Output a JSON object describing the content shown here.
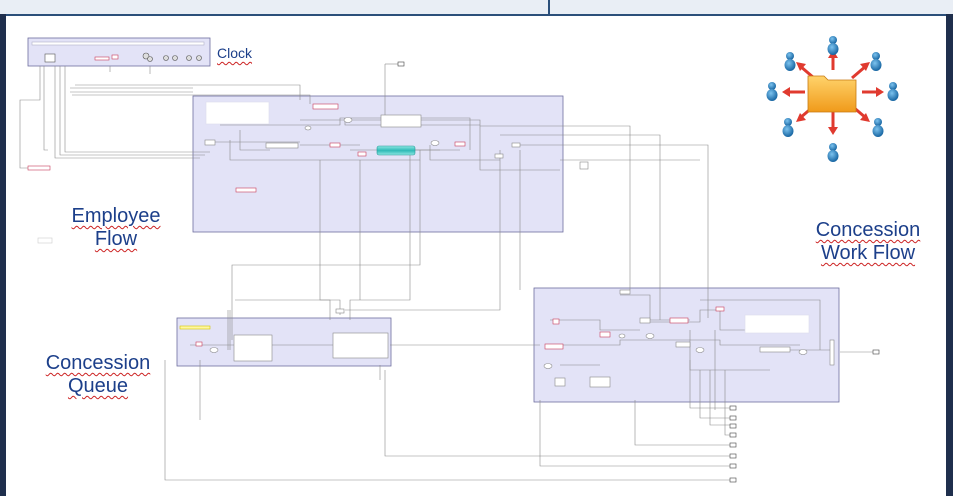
{
  "labels": {
    "clock": "Clock",
    "employee_line1": "Employee",
    "employee_line2": "Flow",
    "concession_queue_line1": "Concession",
    "concession_queue_line2": "Queue",
    "concession_work_line1": "Concession",
    "concession_work_line2": "Work Flow"
  },
  "colors": {
    "label_text": "#1c3f8a",
    "region_fill": "#e3e3f7",
    "region_border": "#6e6e9e",
    "wire": "#8a8a8a",
    "node_accent": "#c83c5a",
    "conveyor": "#45c7c4",
    "folder": "#f4a733",
    "arrow": "#e03a2f",
    "person": "#1b7fc4"
  },
  "icons": {
    "sharing_graphic": "folder-share-icon"
  }
}
